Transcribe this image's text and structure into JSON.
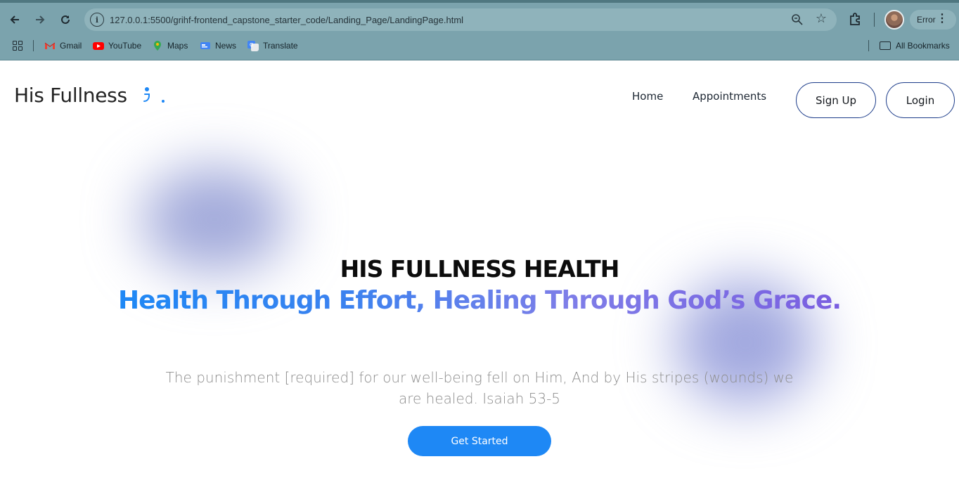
{
  "browser": {
    "url": "127.0.0.1:5500/grihf-frontend_capstone_starter_code/Landing_Page/LandingPage.html",
    "profile_status": "Error",
    "bookmarks": [
      {
        "label": "Gmail",
        "icon": "gmail-icon"
      },
      {
        "label": "YouTube",
        "icon": "youtube-icon"
      },
      {
        "label": "Maps",
        "icon": "maps-icon"
      },
      {
        "label": "News",
        "icon": "news-icon"
      },
      {
        "label": "Translate",
        "icon": "translate-icon"
      }
    ],
    "all_bookmarks": "All Bookmarks"
  },
  "nav": {
    "logo": "His Fullness",
    "links": [
      "Home",
      "Appointments"
    ],
    "signup": "Sign Up",
    "login": "Login"
  },
  "hero": {
    "title": "HIS FULLNESS HEALTH",
    "subtitle": "Health Through Effort, Healing Through God’s Grace.",
    "quote": "The punishment [required] for our well-being fell on Him, And by His stripes (wounds) we are healed. Isaiah 53-5",
    "cta": "Get Started"
  },
  "colors": {
    "accent": "#1e88f5",
    "gradient_end": "#7a5ee0",
    "button_border": "#1c3c8a"
  }
}
